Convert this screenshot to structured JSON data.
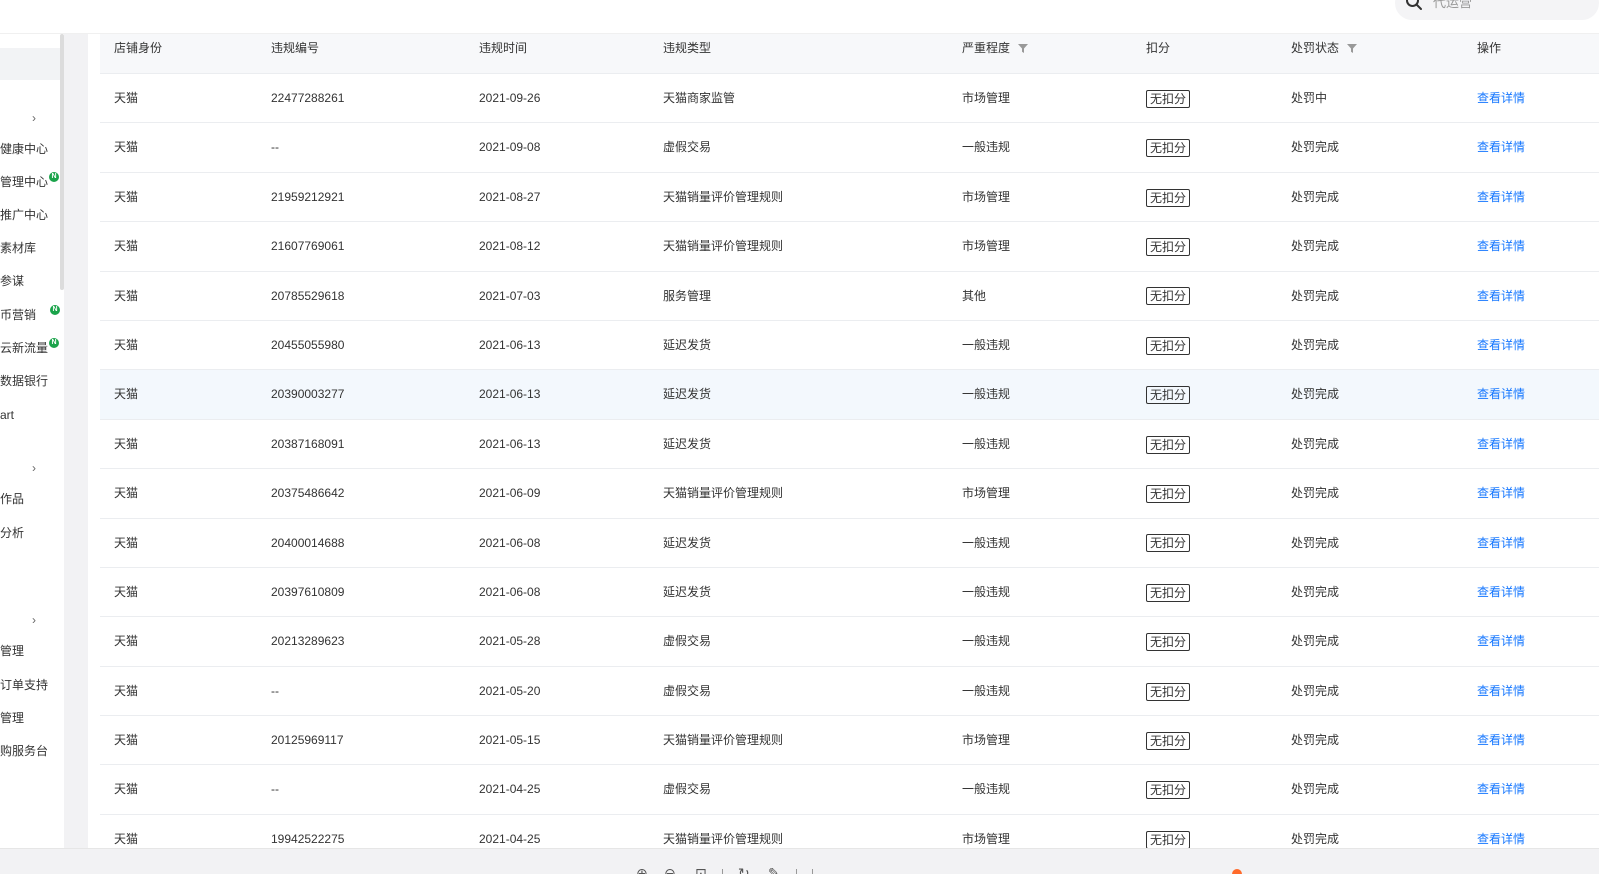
{
  "search": {
    "placeholder": "代运营"
  },
  "sidebar": {
    "items": [
      {
        "label": "",
        "chevron": true
      },
      {
        "label": "健康中心"
      },
      {
        "label": "管理中心",
        "badge": "N"
      },
      {
        "label": "推广中心"
      },
      {
        "label": "素材库"
      },
      {
        "label": "参谋"
      },
      {
        "label": "币营销",
        "badge": "N"
      },
      {
        "label": "云新流量",
        "badge": "N"
      },
      {
        "label": "数据银行"
      },
      {
        "label": "art"
      },
      {
        "label": "",
        "chevron": true
      },
      {
        "label": "作品"
      },
      {
        "label": "分析"
      },
      {
        "label": "",
        "chevron": true
      },
      {
        "label": "管理"
      },
      {
        "label": "订单支持"
      },
      {
        "label": "管理"
      },
      {
        "label": "购服务台"
      }
    ]
  },
  "table": {
    "columns": [
      {
        "key": "shop",
        "label": "店铺身份"
      },
      {
        "key": "id",
        "label": "违规编号"
      },
      {
        "key": "date",
        "label": "违规时间"
      },
      {
        "key": "type",
        "label": "违规类型"
      },
      {
        "key": "severity",
        "label": "严重程度",
        "filter": true
      },
      {
        "key": "points",
        "label": "扣分"
      },
      {
        "key": "status",
        "label": "处罚状态",
        "filter": true
      },
      {
        "key": "action",
        "label": "操作"
      }
    ],
    "action_label": "查看详情",
    "rows": [
      {
        "shop": "天猫",
        "id": "22477288261",
        "date": "2021-09-26",
        "type": "天猫商家监管",
        "severity": "市场管理",
        "points": "无扣分",
        "status": "处罚中"
      },
      {
        "shop": "天猫",
        "id": "--",
        "date": "2021-09-08",
        "type": "虚假交易",
        "severity": "一般违规",
        "points": "无扣分",
        "status": "处罚完成"
      },
      {
        "shop": "天猫",
        "id": "21959212921",
        "date": "2021-08-27",
        "type": "天猫销量评价管理规则",
        "severity": "市场管理",
        "points": "无扣分",
        "status": "处罚完成"
      },
      {
        "shop": "天猫",
        "id": "21607769061",
        "date": "2021-08-12",
        "type": "天猫销量评价管理规则",
        "severity": "市场管理",
        "points": "无扣分",
        "status": "处罚完成"
      },
      {
        "shop": "天猫",
        "id": "20785529618",
        "date": "2021-07-03",
        "type": "服务管理",
        "severity": "其他",
        "points": "无扣分",
        "status": "处罚完成"
      },
      {
        "shop": "天猫",
        "id": "20455055980",
        "date": "2021-06-13",
        "type": "延迟发货",
        "severity": "一般违规",
        "points": "无扣分",
        "status": "处罚完成"
      },
      {
        "shop": "天猫",
        "id": "20390003277",
        "date": "2021-06-13",
        "type": "延迟发货",
        "severity": "一般违规",
        "points": "无扣分",
        "status": "处罚完成",
        "hover": true
      },
      {
        "shop": "天猫",
        "id": "20387168091",
        "date": "2021-06-13",
        "type": "延迟发货",
        "severity": "一般违规",
        "points": "无扣分",
        "status": "处罚完成"
      },
      {
        "shop": "天猫",
        "id": "20375486642",
        "date": "2021-06-09",
        "type": "天猫销量评价管理规则",
        "severity": "市场管理",
        "points": "无扣分",
        "status": "处罚完成"
      },
      {
        "shop": "天猫",
        "id": "20400014688",
        "date": "2021-06-08",
        "type": "延迟发货",
        "severity": "一般违规",
        "points": "无扣分",
        "status": "处罚完成"
      },
      {
        "shop": "天猫",
        "id": "20397610809",
        "date": "2021-06-08",
        "type": "延迟发货",
        "severity": "一般违规",
        "points": "无扣分",
        "status": "处罚完成"
      },
      {
        "shop": "天猫",
        "id": "20213289623",
        "date": "2021-05-28",
        "type": "虚假交易",
        "severity": "一般违规",
        "points": "无扣分",
        "status": "处罚完成"
      },
      {
        "shop": "天猫",
        "id": "--",
        "date": "2021-05-20",
        "type": "虚假交易",
        "severity": "一般违规",
        "points": "无扣分",
        "status": "处罚完成"
      },
      {
        "shop": "天猫",
        "id": "20125969117",
        "date": "2021-05-15",
        "type": "天猫销量评价管理规则",
        "severity": "市场管理",
        "points": "无扣分",
        "status": "处罚完成"
      },
      {
        "shop": "天猫",
        "id": "--",
        "date": "2021-04-25",
        "type": "虚假交易",
        "severity": "一般违规",
        "points": "无扣分",
        "status": "处罚完成"
      },
      {
        "shop": "天猫",
        "id": "19942522275",
        "date": "2021-04-25",
        "type": "天猫销量评价管理规则",
        "severity": "市场管理",
        "points": "无扣分",
        "status": "处罚完成"
      }
    ]
  },
  "toolbar": {
    "icons": [
      "zoom-in-icon",
      "zoom-out-icon",
      "fit-screen-icon",
      "rotate-icon",
      "edit-icon",
      "more-icon"
    ]
  },
  "colors": {
    "link": "#1677ff",
    "badge": "#1aa34a",
    "header_bg": "#f7f8fa",
    "hover_row": "#f3f8fd"
  }
}
